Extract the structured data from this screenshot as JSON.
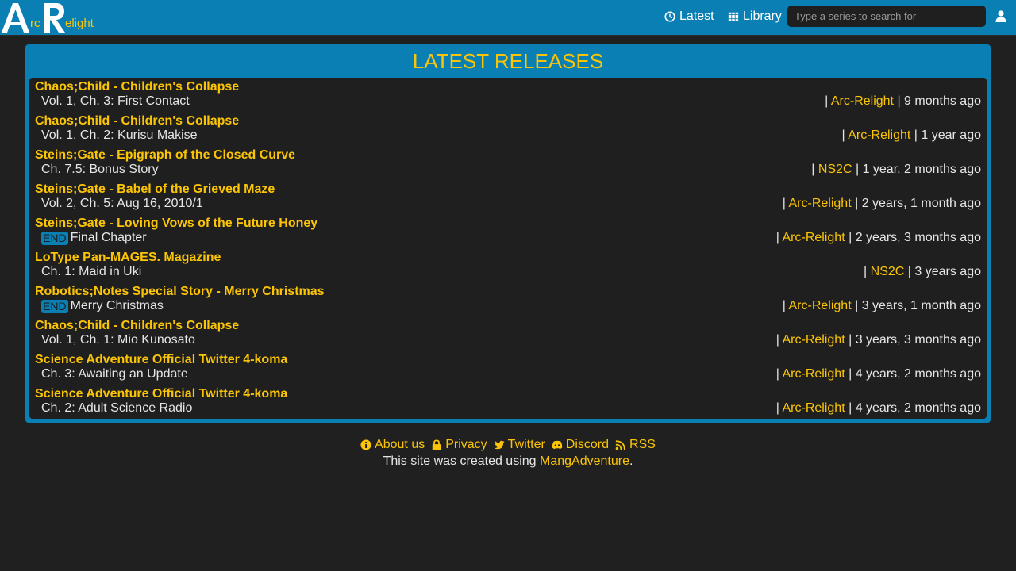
{
  "colors": {
    "header": "#0a7fb4",
    "accent": "#fbc506",
    "background": "#202020"
  },
  "header": {
    "logo_text": "ArcRelight",
    "nav": {
      "latest": "Latest",
      "library": "Library"
    },
    "search_placeholder": "Type a series to search for",
    "icons": {
      "latest": "clock-icon",
      "library": "books-icon",
      "user": "user-icon"
    }
  },
  "panel": {
    "title": "LATEST RELEASES",
    "releases": [
      {
        "series": "Chaos;Child - Children's Collapse",
        "chapter": "Vol. 1, Ch. 3: First Contact",
        "badge": "",
        "group": "Arc-Relight",
        "age": "9 months ago"
      },
      {
        "series": "Chaos;Child - Children's Collapse",
        "chapter": "Vol. 1, Ch. 2: Kurisu Makise",
        "badge": "",
        "group": "Arc-Relight",
        "age": "1 year ago"
      },
      {
        "series": "Steins;Gate - Epigraph of the Closed Curve",
        "chapter": "Ch. 7.5: Bonus Story",
        "badge": "",
        "group": "NS2C",
        "age": "1 year, 2 months ago"
      },
      {
        "series": "Steins;Gate - Babel of the Grieved Maze",
        "chapter": "Vol. 2, Ch. 5: Aug 16, 2010/1",
        "badge": "",
        "group": "Arc-Relight",
        "age": "2 years, 1 month ago"
      },
      {
        "series": "Steins;Gate - Loving Vows of the Future Honey",
        "chapter": "Final Chapter",
        "badge": "END",
        "group": "Arc-Relight",
        "age": "2 years, 3 months ago"
      },
      {
        "series": "LoType Pan-MAGES. Magazine",
        "chapter": "Ch. 1: Maid in Uki",
        "badge": "",
        "group": "NS2C",
        "age": "3 years ago"
      },
      {
        "series": "Robotics;Notes Special Story - Merry Christmas",
        "chapter": "Merry Christmas",
        "badge": "END",
        "group": "Arc-Relight",
        "age": "3 years, 1 month ago"
      },
      {
        "series": "Chaos;Child - Children's Collapse",
        "chapter": "Vol. 1, Ch. 1: Mio Kunosato",
        "badge": "",
        "group": "Arc-Relight",
        "age": "3 years, 3 months ago"
      },
      {
        "series": "Science Adventure Official Twitter 4-koma",
        "chapter": "Ch. 3: Awaiting an Update",
        "badge": "",
        "group": "Arc-Relight",
        "age": "4 years, 2 months ago"
      },
      {
        "series": "Science Adventure Official Twitter 4-koma",
        "chapter": "Ch. 2: Adult Science Radio",
        "badge": "",
        "group": "Arc-Relight",
        "age": "4 years, 2 months ago"
      }
    ]
  },
  "footer": {
    "links": [
      {
        "label": "About us",
        "icon": "info-icon"
      },
      {
        "label": "Privacy",
        "icon": "lock-icon"
      },
      {
        "label": "Twitter",
        "icon": "twitter-icon"
      },
      {
        "label": "Discord",
        "icon": "discord-icon"
      },
      {
        "label": "RSS",
        "icon": "rss-icon"
      }
    ],
    "credits_prefix": "This site was created using ",
    "credits_link": "MangAdventure",
    "credits_suffix": "."
  }
}
